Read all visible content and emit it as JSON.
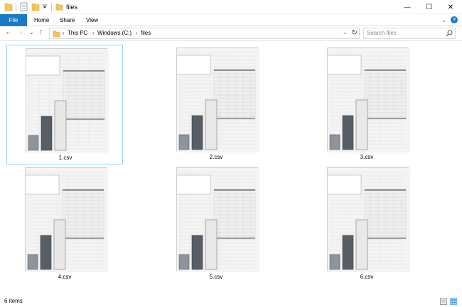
{
  "window": {
    "title": "files",
    "minimize_glyph": "—",
    "maximize_glyph": "☐",
    "close_glyph": "✕"
  },
  "ribbon": {
    "tabs": [
      "File",
      "Home",
      "Share",
      "View"
    ],
    "expand_glyph": "⌄",
    "help_glyph": "?"
  },
  "nav": {
    "back_glyph": "←",
    "forward_glyph": "→",
    "recent_glyph": "⌄",
    "up_glyph": "↑",
    "breadcrumb": [
      "This PC",
      "Windows (C:)",
      "files"
    ],
    "crumb_sep": "›",
    "refresh_glyph": "↻",
    "dropdown_glyph": "⌄"
  },
  "search": {
    "placeholder": "Search files"
  },
  "files": [
    {
      "name": "1.csv",
      "selected": true
    },
    {
      "name": "2.csv",
      "selected": false
    },
    {
      "name": "3.csv",
      "selected": false
    },
    {
      "name": "4.csv",
      "selected": false
    },
    {
      "name": "5.csv",
      "selected": false
    },
    {
      "name": "6.csv",
      "selected": false
    }
  ],
  "status": {
    "item_count": "6 items"
  },
  "colors": {
    "accent": "#1979ca",
    "selection_border": "#99d1ff",
    "folder": "#f2c55c"
  },
  "icons": {
    "file_thumbnail": "spreadsheet-chart-icon",
    "folder": "folder-icon",
    "search": "search-icon"
  }
}
